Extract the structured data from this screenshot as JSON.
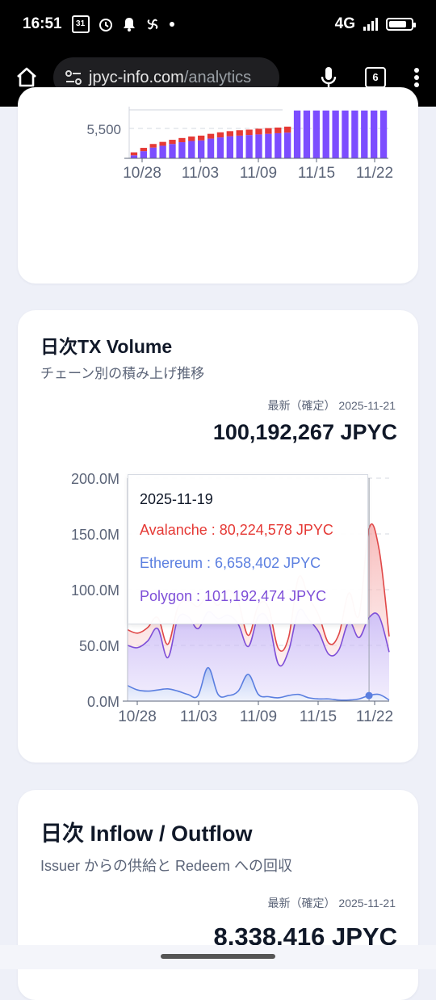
{
  "status_bar": {
    "time": "16:51",
    "calendar_day": "31",
    "network": "4G"
  },
  "browser": {
    "url_host": "jpyc-info.com",
    "url_path": "/analytics",
    "tab_count": "6"
  },
  "card1": {
    "chart_data": {
      "type": "bar",
      "y_tick_labels": [
        "5,500"
      ],
      "x_tick_labels": [
        "10/28",
        "11/03",
        "11/09",
        "11/15",
        "11/22"
      ],
      "series": [
        {
          "color": "#7c4dff",
          "values": [
            5050,
            5120,
            5180,
            5210,
            5240,
            5270,
            5290,
            5300,
            5330,
            5350,
            5370,
            5380,
            5390,
            5400,
            5410,
            5420,
            5430,
            5800,
            5800,
            5800,
            5800,
            5800,
            5800,
            5800,
            5800,
            5800,
            5800
          ]
        },
        {
          "color": "#e53935",
          "values": [
            50,
            55,
            60,
            65,
            70,
            70,
            75,
            80,
            80,
            85,
            85,
            90,
            90,
            95,
            95,
            95,
            100,
            0,
            0,
            0,
            0,
            0,
            0,
            0,
            0,
            0,
            0
          ]
        }
      ]
    }
  },
  "card2": {
    "title": "日次TX Volume",
    "subtitle": "チェーン別の積み上げ推移",
    "latest_label": "最新（確定） 2025-11-21",
    "latest_value": "100,192,267 JPYC",
    "chart_data": {
      "type": "area",
      "ylim": [
        0,
        200
      ],
      "y_ticks": [
        0,
        50,
        100,
        150,
        200
      ],
      "y_tick_labels": [
        "0.0M",
        "50.0M",
        "100.0M",
        "150.0M",
        "200.0M"
      ],
      "x_tick_labels": [
        "10/28",
        "11/03",
        "11/09",
        "11/15",
        "11/22"
      ],
      "x_ticks": [
        1,
        7,
        13,
        19,
        26
      ],
      "n_points": 27,
      "series": [
        {
          "name": "Ethereum",
          "color": "#5b7fe0",
          "values": [
            14,
            10,
            9,
            10,
            11,
            9,
            6,
            5,
            30,
            6,
            5,
            9,
            24,
            6,
            4,
            3,
            5,
            6,
            3,
            2,
            2,
            1,
            1,
            2,
            5,
            6,
            1
          ]
        },
        {
          "name": "Polygon",
          "color": "#7e4fd8",
          "values": [
            36,
            38,
            45,
            55,
            28,
            65,
            70,
            60,
            50,
            68,
            72,
            60,
            25,
            70,
            68,
            30,
            40,
            75,
            70,
            60,
            40,
            45,
            70,
            55,
            70,
            70,
            43
          ]
        },
        {
          "name": "Avalanche",
          "color": "#e04848",
          "values": [
            14,
            13,
            12,
            10,
            12,
            10,
            14,
            20,
            15,
            12,
            22,
            20,
            10,
            10,
            12,
            14,
            12,
            30,
            20,
            15,
            10,
            14,
            26,
            20,
            80,
            60,
            14
          ]
        }
      ]
    },
    "tooltip": {
      "date": "2025-11-19",
      "rows": [
        {
          "label": "Avalanche : 80,224,578 JPYC",
          "color": "#e53935"
        },
        {
          "label": "Ethereum : 6,658,402 JPYC",
          "color": "#5b7fe0"
        },
        {
          "label": "Polygon : 101,192,474 JPYC",
          "color": "#7e4fd8"
        }
      ]
    }
  },
  "card3": {
    "title": "日次 Inflow / Outflow",
    "subtitle": "Issuer からの供給と Redeem への回収",
    "latest_label": "最新（確定） 2025-11-21",
    "latest_value": "8,338,416 JPYC"
  }
}
